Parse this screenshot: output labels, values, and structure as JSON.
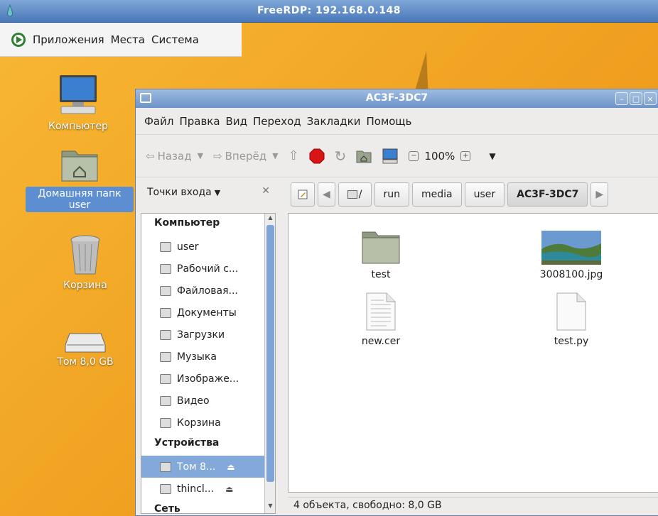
{
  "rdp": {
    "title": "FreeRDP: 192.168.0.148"
  },
  "top_panel": {
    "menus": [
      "Приложения",
      "Места",
      "Система"
    ]
  },
  "desktop_icons": [
    {
      "label": "Компьютер",
      "icon": "computer-icon"
    },
    {
      "label": "Домашняя папк\nuser",
      "label_line1": "Домашняя папк",
      "label_line2": "user",
      "icon": "home-folder-icon"
    },
    {
      "label": "Корзина",
      "icon": "trash-icon"
    },
    {
      "label": "Том 8,0 GB",
      "icon": "drive-icon"
    }
  ],
  "window": {
    "title": "AC3F-3DC7",
    "menubar": [
      "Файл",
      "Правка",
      "Вид",
      "Переход",
      "Закладки",
      "Помощь"
    ],
    "toolbar": {
      "back": "Назад",
      "forward": "Вперёд",
      "zoom": "100%"
    },
    "sidebar_header": "Точки входа",
    "pathbar": [
      "/",
      "run",
      "media",
      "user",
      "AC3F-3DC7"
    ],
    "sidebar": {
      "section_computer": "Компьютер",
      "computer_items": [
        "user",
        "Рабочий с...",
        "Файловая...",
        "Документы",
        "Загрузки",
        "Музыка",
        "Изображе...",
        "Видео",
        "Корзина"
      ],
      "section_devices": "Устройства",
      "device_items": [
        "Том 8...",
        "thincl..."
      ],
      "section_network": "Сеть"
    },
    "files": [
      {
        "name": "test",
        "type": "folder"
      },
      {
        "name": "3008100.jpg",
        "type": "image"
      },
      {
        "name": "new.cer",
        "type": "text-file"
      },
      {
        "name": "test.py",
        "type": "blank-file"
      }
    ],
    "status": "4 объекта, свободно: 8,0 GB"
  }
}
